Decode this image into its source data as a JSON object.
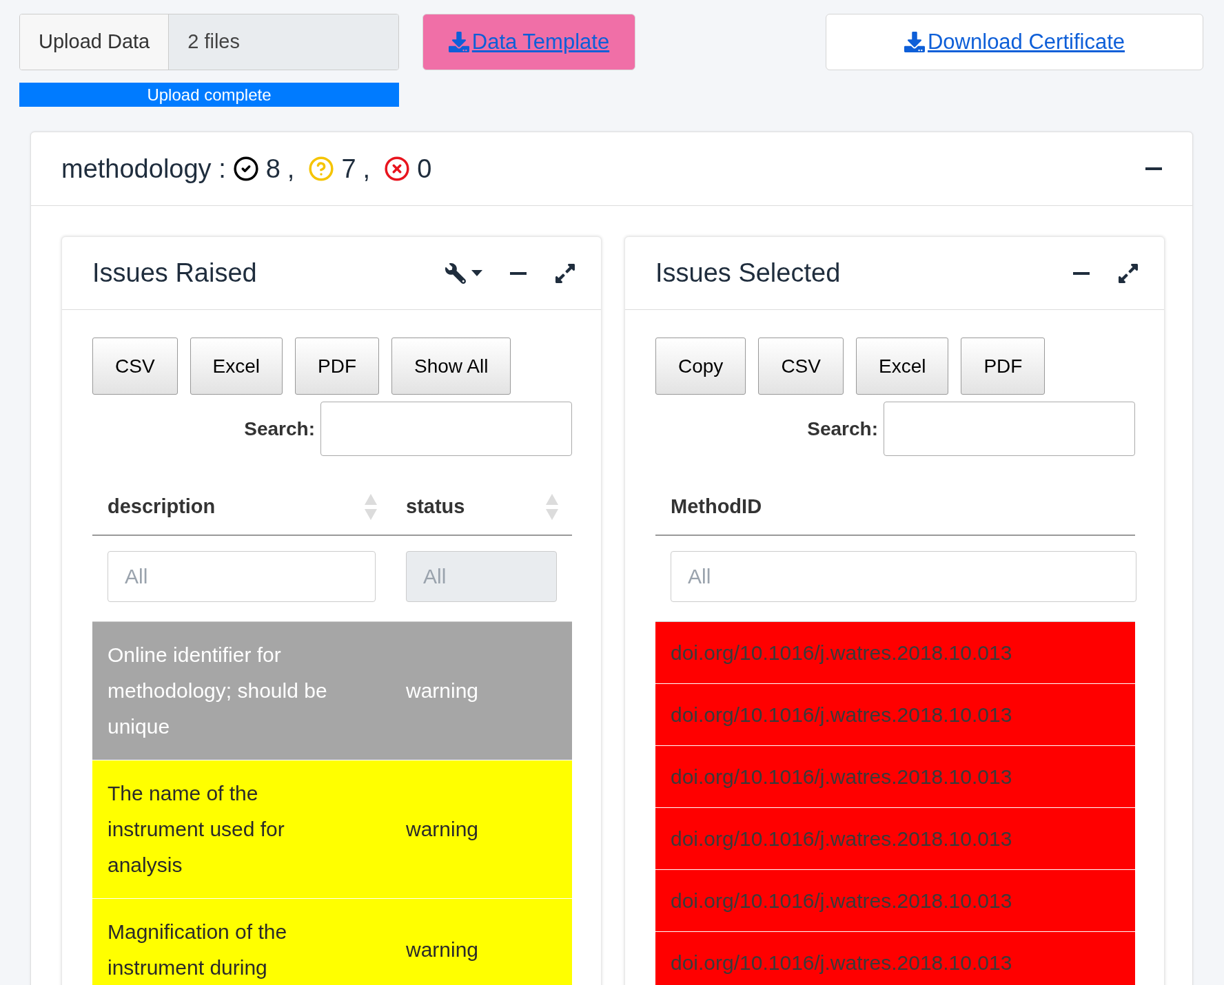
{
  "upload": {
    "button": "Upload Data",
    "file_text": "2 files",
    "progress": {
      "level": 1,
      "label": "Upload complete"
    }
  },
  "links": [
    {
      "label": "Data Template",
      "kind": "primary"
    },
    {
      "label": "Download Certificate",
      "kind": "plain"
    }
  ],
  "card": {
    "title": "methodology :",
    "counts": [
      {
        "kind": "ok",
        "value": "8",
        "sep": ","
      },
      {
        "kind": "warn",
        "value": "7",
        "sep": ","
      },
      {
        "kind": "error",
        "value": "0"
      }
    ],
    "expanded": true
  },
  "panels": [
    {
      "title": "Issues Raised",
      "tools": true,
      "buttons": [
        "CSV",
        "Excel",
        "PDF",
        "Show All"
      ],
      "search_label": "Search:",
      "columns": [
        {
          "label": "description",
          "sortable": true,
          "placeholder": "All",
          "disabled": false
        },
        {
          "label": "status",
          "sortable": true,
          "placeholder": "All",
          "disabled": true
        }
      ],
      "rows": [
        {
          "color": "#a6a6a6",
          "cells": [
            "Online identifier for methodology; should be unique",
            "warning"
          ]
        },
        {
          "color": "#ffff00",
          "cells": [
            "The name of the instrument used for analysis",
            "warning"
          ]
        },
        {
          "color": "#ffff00",
          "cells": [
            "Magnification of the instrument during",
            "warning"
          ]
        }
      ]
    },
    {
      "title": "Issues Selected",
      "tools": false,
      "buttons": [
        "Copy",
        "CSV",
        "Excel",
        "PDF"
      ],
      "search_label": "Search:",
      "columns": [
        {
          "label": "MethodID",
          "sortable": false,
          "placeholder": "All",
          "disabled": false
        }
      ],
      "rows": [
        {
          "color": "#ff0000",
          "cells": [
            "doi.org/10.1016/j.watres.2018.10.013"
          ]
        },
        {
          "color": "#ff0000",
          "cells": [
            "doi.org/10.1016/j.watres.2018.10.013"
          ]
        },
        {
          "color": "#ff0000",
          "cells": [
            "doi.org/10.1016/j.watres.2018.10.013"
          ]
        },
        {
          "color": "#ff0000",
          "cells": [
            "doi.org/10.1016/j.watres.2018.10.013"
          ]
        },
        {
          "color": "#ff0000",
          "cells": [
            "doi.org/10.1016/j.watres.2018.10.013"
          ]
        },
        {
          "color": "#ff0000",
          "cells": [
            "doi.org/10.1016/j.watres.2018.10.013"
          ]
        }
      ]
    }
  ]
}
